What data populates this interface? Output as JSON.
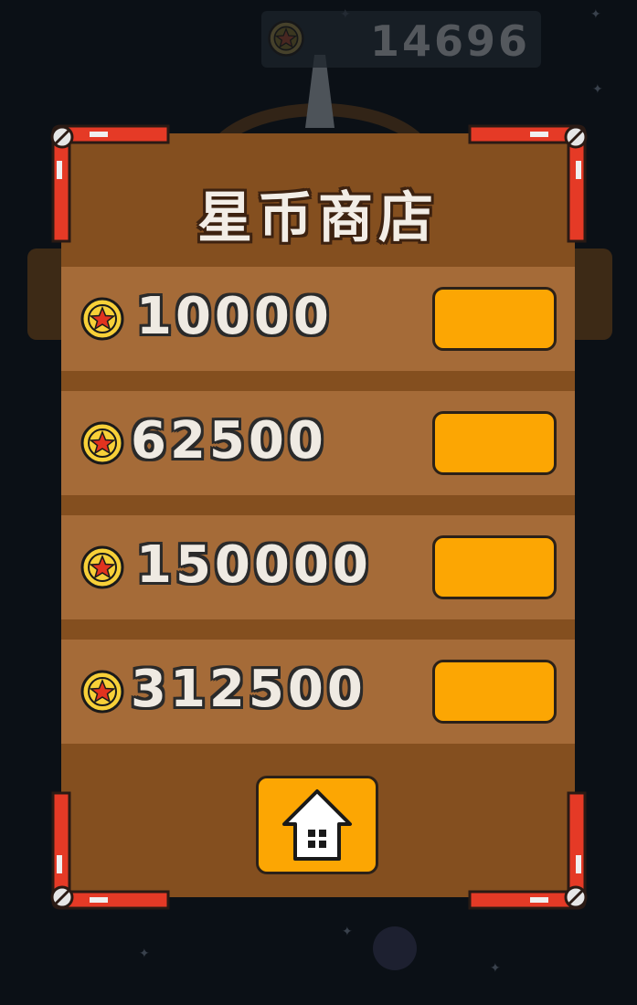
{
  "header": {
    "coin_balance": "14696",
    "coin_icon": "star-coin-icon"
  },
  "shop": {
    "title": "星币商店",
    "items": [
      {
        "price": "10000"
      },
      {
        "price": "62500"
      },
      {
        "price": "150000"
      },
      {
        "price": "312500"
      }
    ],
    "home_icon": "home-icon"
  },
  "colors": {
    "background": "#0b1016",
    "panel": "#844f1f",
    "row": "#a56b38",
    "button": "#fca603",
    "frame_red": "#e53a26",
    "coin_gold": "#f7d038",
    "coin_star": "#e2331f"
  }
}
